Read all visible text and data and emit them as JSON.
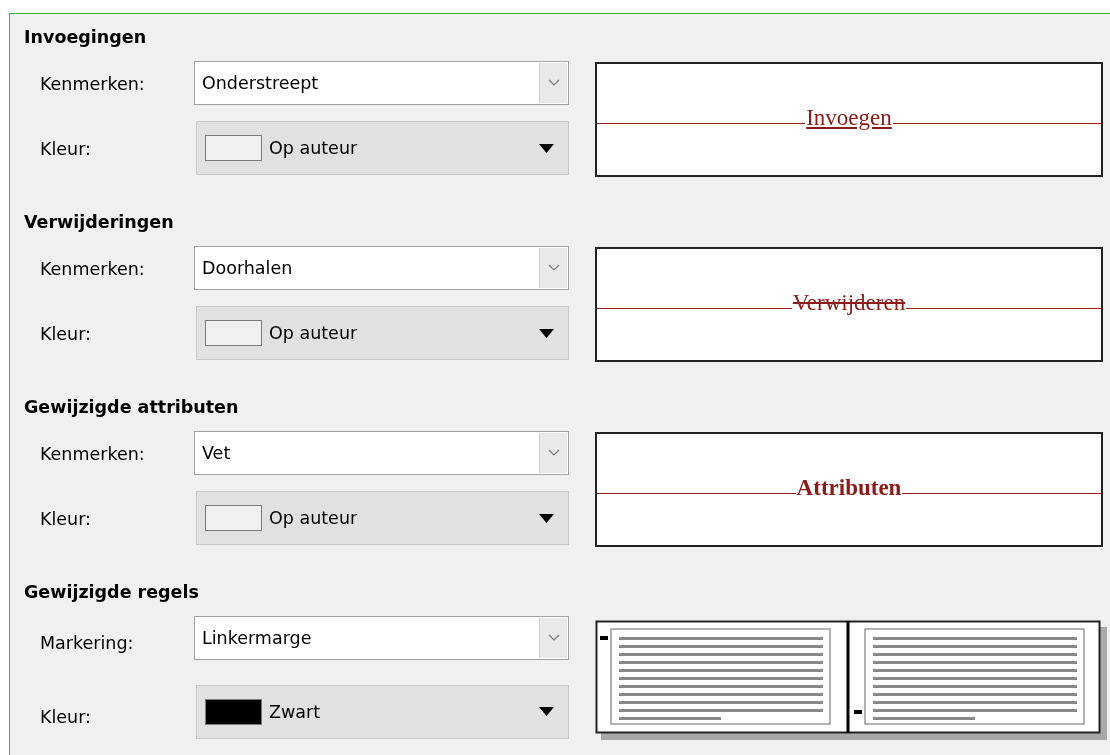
{
  "sections": [
    {
      "title": "Invoegingen",
      "attribute": {
        "label": "Kenmerken:",
        "value": "Onderstreept"
      },
      "color": {
        "label": "Kleur:",
        "value": "Op auteur",
        "color": "#f0f0f0"
      },
      "preview": {
        "kind": "underline",
        "text": "Invoegen"
      }
    },
    {
      "title": "Verwijderingen",
      "attribute": {
        "label": "Kenmerken:",
        "value": "Doorhalen"
      },
      "color": {
        "label": "Kleur:",
        "value": "Op auteur",
        "color": "#f0f0f0"
      },
      "preview": {
        "kind": "strikethrough",
        "text": "Verwijderen"
      }
    },
    {
      "title": "Gewijzigde attributen",
      "attribute": {
        "label": "Kenmerken:",
        "value": "Vet"
      },
      "color": {
        "label": "Kleur:",
        "value": "Op auteur",
        "color": "#f0f0f0"
      },
      "preview": {
        "kind": "bold",
        "text": "Attributen"
      }
    },
    {
      "title": "Gewijzigde regels",
      "attribute": {
        "label": "Markering:",
        "value": "Linkermarge"
      },
      "color": {
        "label": "Kleur:",
        "value": "Zwart",
        "color": "#000000"
      },
      "preview": {
        "kind": "pages"
      }
    }
  ]
}
